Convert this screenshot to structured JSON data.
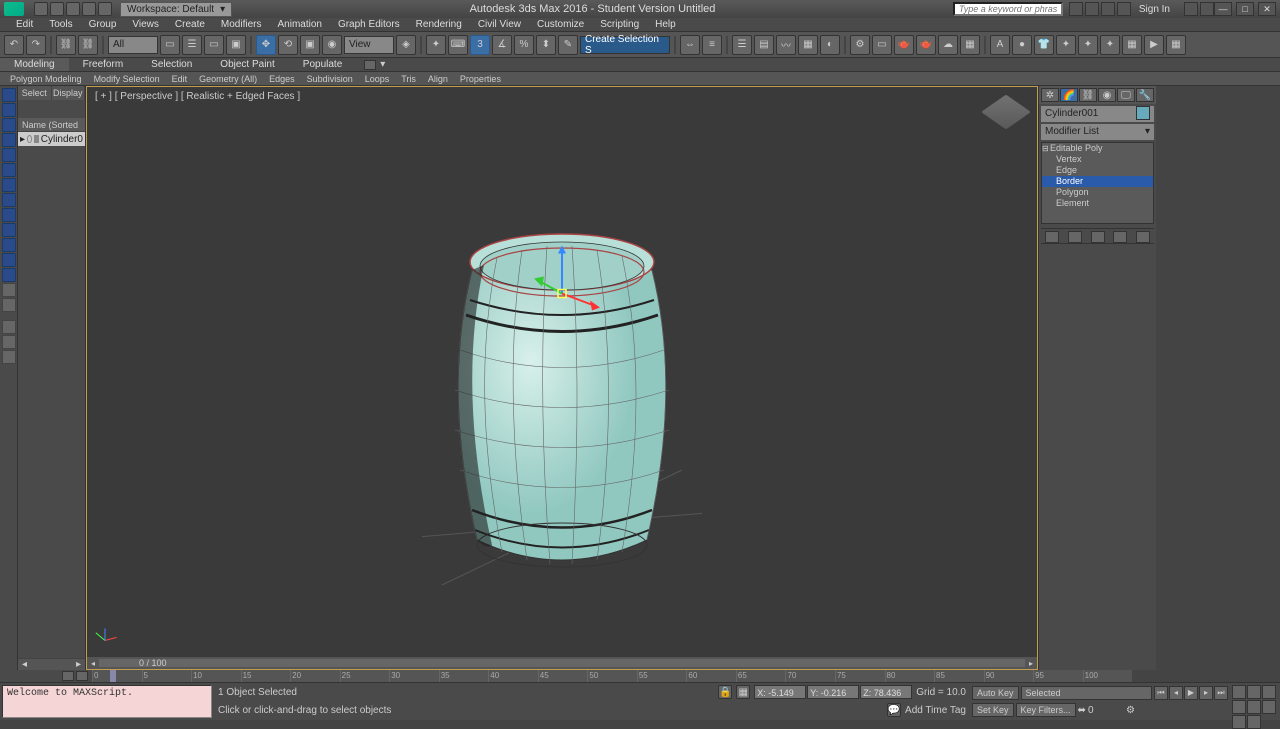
{
  "title": "Autodesk 3ds Max 2016 - Student Version   Untitled",
  "workspace": "Workspace: Default",
  "search_placeholder": "Type a keyword or phrase",
  "signin": "Sign In",
  "menus": [
    "Edit",
    "Tools",
    "Group",
    "Views",
    "Create",
    "Modifiers",
    "Animation",
    "Graph Editors",
    "Rendering",
    "Civil View",
    "Customize",
    "Scripting",
    "Help"
  ],
  "toolbar_sel1": "All",
  "toolbar_sel2": "View",
  "toolbar_sel3": "Create Selection S",
  "ribbon_tabs": [
    "Modeling",
    "Freeform",
    "Selection",
    "Object Paint",
    "Populate"
  ],
  "subribbon": [
    "Polygon Modeling",
    "Modify Selection",
    "Edit",
    "Geometry (All)",
    "Edges",
    "Subdivision",
    "Loops",
    "Tris",
    "Align",
    "Properties"
  ],
  "outliner": {
    "tabs": [
      "Select",
      "Display"
    ],
    "header": "Name (Sorted Ascen",
    "item": "Cylinder0"
  },
  "viewport_label": "[ + ] [ Perspective ] [ Realistic + Edged Faces ]",
  "slider_label": "0 / 100",
  "cmd": {
    "objname": "Cylinder001",
    "modlist": "Modifier List",
    "stack": [
      "Editable Poly",
      "Vertex",
      "Edge",
      "Border",
      "Polygon",
      "Element"
    ]
  },
  "timeline_ticks": [
    "0",
    "5",
    "10",
    "15",
    "20",
    "25",
    "30",
    "35",
    "40",
    "45",
    "50",
    "55",
    "60",
    "65",
    "70",
    "75",
    "80",
    "85",
    "90",
    "95",
    "100"
  ],
  "status": {
    "script": "Welcome to MAXScript.",
    "selinfo": "1 Object Selected",
    "prompt": "Click or click-and-drag to select objects",
    "x": "X: -5.149",
    "y": "Y: -0.216",
    "z": "Z: 78.436",
    "grid": "Grid = 10.0",
    "addtime": "Add Time Tag",
    "autokey": "Auto Key",
    "setkey": "Set Key",
    "selected": "Selected",
    "keyfilters": "Key Filters...",
    "frame": "0"
  }
}
